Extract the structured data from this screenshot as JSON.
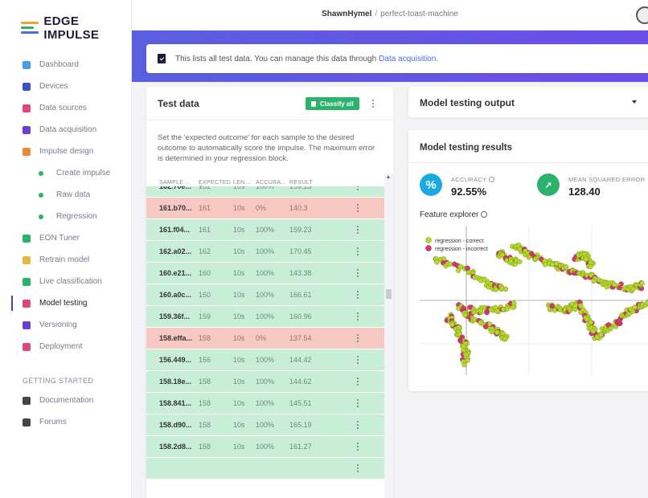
{
  "app": {
    "name": "EDGE IMPULSE"
  },
  "breadcrumb": {
    "user": "ShawnHymel",
    "separator": "/",
    "project": "perfect-toast-machine"
  },
  "sidebar": {
    "items": [
      {
        "label": "Dashboard",
        "icon": "monitor-icon",
        "color": "#4a9be0"
      },
      {
        "label": "Devices",
        "icon": "chip-icon",
        "color": "#3b4fc9"
      },
      {
        "label": "Data sources",
        "icon": "wrench-icon",
        "color": "#e0477a"
      },
      {
        "label": "Data acquisition",
        "icon": "database-icon",
        "color": "#6a3fd1"
      },
      {
        "label": "Impulse design",
        "icon": "pulse-icon",
        "color": "#e88a3a"
      },
      {
        "label": "Create impulse",
        "sub": true
      },
      {
        "label": "Raw data",
        "sub": true
      },
      {
        "label": "Regression",
        "sub": true
      },
      {
        "label": "EON Tuner",
        "icon": "tuner-icon",
        "color": "#2bb36d"
      },
      {
        "label": "Retrain model",
        "icon": "shuffle-icon",
        "color": "#e8b83a"
      },
      {
        "label": "Live classification",
        "icon": "people-icon",
        "color": "#2bb36d"
      },
      {
        "label": "Model testing",
        "icon": "flask-icon",
        "color": "#e0477a",
        "active": true
      },
      {
        "label": "Versioning",
        "icon": "branch-icon",
        "color": "#6a3fd1"
      },
      {
        "label": "Deployment",
        "icon": "package-icon",
        "color": "#e0477a"
      }
    ],
    "section": "GETTING STARTED",
    "items2": [
      {
        "label": "Documentation",
        "icon": "docs-icon",
        "color": "#444"
      },
      {
        "label": "Forums",
        "icon": "chat-icon",
        "color": "#444"
      }
    ]
  },
  "infobar": {
    "text": "This lists all test data. You can manage this data through",
    "link": "Data acquisition",
    "end": "."
  },
  "test_data": {
    "title": "Test data",
    "classify_label": "Classify all",
    "description": "Set the 'expected outcome' for each sample to the desired outcome to automatically score the impulse. The maximum error is determined in your regression block.",
    "columns": [
      "SAMPLE ...",
      "EXPECTED O...",
      "LEN...",
      "ACCURA...",
      "RESULT"
    ],
    "rows": [
      {
        "sample": "162.70e...",
        "expected": "162",
        "length": "10s",
        "accuracy": "100%",
        "result": "159.13",
        "status": "ok"
      },
      {
        "sample": "161.b70...",
        "expected": "161",
        "length": "10s",
        "accuracy": "0%",
        "result": "140.3",
        "status": "bad"
      },
      {
        "sample": "161.f04...",
        "expected": "161",
        "length": "10s",
        "accuracy": "100%",
        "result": "159.23",
        "status": "ok"
      },
      {
        "sample": "162.a02...",
        "expected": "162",
        "length": "10s",
        "accuracy": "100%",
        "result": "170.45",
        "status": "ok"
      },
      {
        "sample": "160.e21...",
        "expected": "160",
        "length": "10s",
        "accuracy": "100%",
        "result": "143.38",
        "status": "ok"
      },
      {
        "sample": "160.a0c...",
        "expected": "160",
        "length": "10s",
        "accuracy": "100%",
        "result": "166.61",
        "status": "ok"
      },
      {
        "sample": "159.36f...",
        "expected": "159",
        "length": "10s",
        "accuracy": "100%",
        "result": "160.96",
        "status": "ok"
      },
      {
        "sample": "158.effa...",
        "expected": "158",
        "length": "10s",
        "accuracy": "0%",
        "result": "137.54",
        "status": "bad"
      },
      {
        "sample": "156.449...",
        "expected": "156",
        "length": "10s",
        "accuracy": "100%",
        "result": "144.42",
        "status": "ok"
      },
      {
        "sample": "158.18e...",
        "expected": "158",
        "length": "10s",
        "accuracy": "100%",
        "result": "144.62",
        "status": "ok"
      },
      {
        "sample": "158.841...",
        "expected": "158",
        "length": "10s",
        "accuracy": "100%",
        "result": "145.51",
        "status": "ok"
      },
      {
        "sample": "158.d90...",
        "expected": "158",
        "length": "10s",
        "accuracy": "100%",
        "result": "165.19",
        "status": "ok"
      },
      {
        "sample": "158.2d8...",
        "expected": "158",
        "length": "10s",
        "accuracy": "100%",
        "result": "161.27",
        "status": "ok"
      },
      {
        "sample": "",
        "expected": "",
        "length": "",
        "accuracy": "",
        "result": "",
        "status": "ok"
      }
    ]
  },
  "output": {
    "title": "Model testing output"
  },
  "results": {
    "title": "Model testing results",
    "accuracy_label": "ACCURACY",
    "accuracy_value": "92.55%",
    "mse_label": "MEAN SQUARED ERROR",
    "mse_value": "128.40",
    "feature_explorer_label": "Feature explorer",
    "legend_correct": "regression - correct",
    "legend_incorrect": "regression - incorrect",
    "colors": {
      "correct": "#b5d62a",
      "incorrect": "#d23a6e",
      "accuracy": "#1aa9e0",
      "mse": "#2bb36d"
    }
  }
}
